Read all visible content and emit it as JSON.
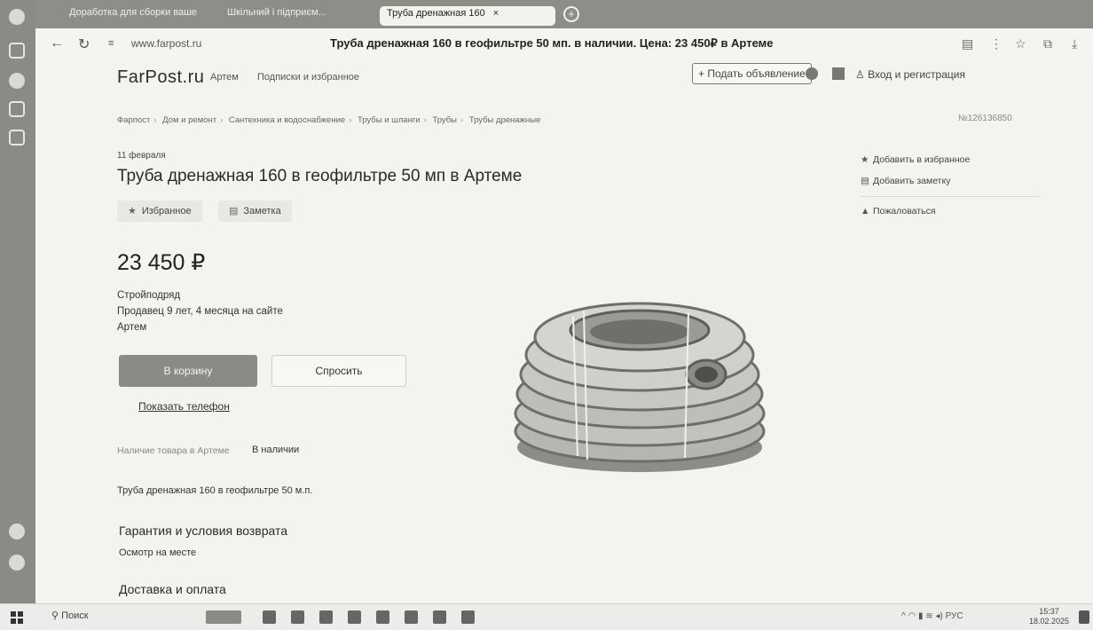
{
  "browser": {
    "tabs": [
      {
        "label": "Доработка для сборки ваше",
        "active": false
      },
      {
        "label": "Шкільний і підприєм...",
        "active": false
      },
      {
        "label": "Труба дренажная 160",
        "active": true
      }
    ],
    "tab_close": "×",
    "new_tab": "+",
    "url": "www.farpost.ru",
    "page_title": "Труба дренажная 160 в геофильтре 50 мп. в наличии. Цена: 23 450₽ в Артеме"
  },
  "header": {
    "logo": "FarPost.ru",
    "city": "Артем",
    "subscriptions": "Подписки и избранное",
    "post_ad": "+ Подать объявление",
    "login": "Вход и регистрация"
  },
  "breadcrumb": [
    "Фарпост",
    "Дом и ремонт",
    "Сантехника и водоснабжение",
    "Трубы и шланги",
    "Трубы",
    "Трубы дренажные"
  ],
  "ad": {
    "number": "№126136850",
    "date": "11 февраля",
    "title": "Труба дренажная 160 в геофильтре 50 мп в Артеме",
    "favorite_chip": "Избранное",
    "note_chip": "Заметка",
    "price": "23 450 ₽",
    "seller_name": "Стройподряд",
    "seller_since": "Продавец 9 лет, 4 месяца на сайте",
    "seller_city": "Артем",
    "cart_button": "В корзину",
    "ask_button": "Спросить",
    "show_phone": "Показать телефон",
    "availability_label": "Наличие товара в Артеме",
    "availability_value": "В наличии",
    "description": "Труба дренажная 160 в геофильтре 50 м.п.",
    "warranty_title": "Гарантия и условия возврата",
    "warranty_text": "Осмотр на месте",
    "delivery_title": "Доставка и оплата"
  },
  "side_actions": {
    "add_favorite": "Добавить в избранное",
    "add_note": "Добавить заметку",
    "complain": "Пожаловаться"
  },
  "taskbar": {
    "search": "Поиск",
    "language": "РУС",
    "time": "15:37",
    "date": "18.02.2025"
  }
}
